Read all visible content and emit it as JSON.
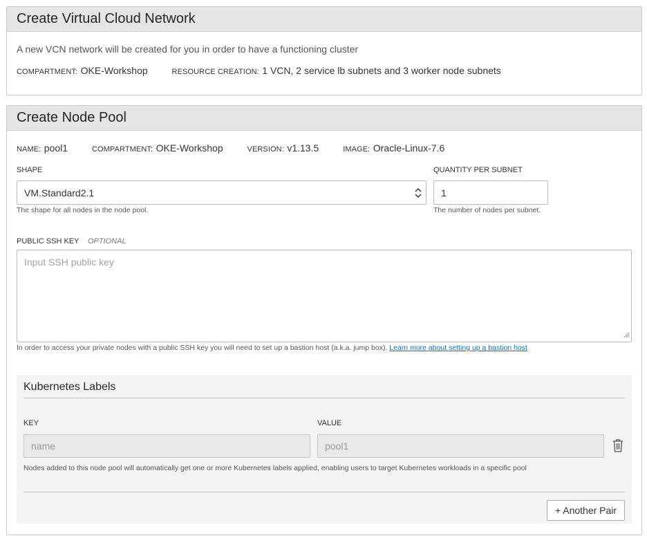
{
  "vcn": {
    "title": "Create Virtual Cloud Network",
    "description": "A new VCN network will be created for you in order to have a functioning cluster",
    "compartment_label": "COMPARTMENT:",
    "compartment_value": "OKE-Workshop",
    "resource_label": "RESOURCE CREATION:",
    "resource_value": "1 VCN, 2 service lb subnets and 3 worker node subnets"
  },
  "node_pool": {
    "title": "Create Node Pool",
    "name_label": "NAME:",
    "name_value": "pool1",
    "compartment_label": "COMPARTMENT:",
    "compartment_value": "OKE-Workshop",
    "version_label": "VERSION:",
    "version_value": "v1.13.5",
    "image_label": "IMAGE:",
    "image_value": "Oracle-Linux-7.6",
    "shape": {
      "label": "SHAPE",
      "value": "VM.Standard2.1",
      "help": "The shape for all nodes in the node pool."
    },
    "quantity": {
      "label": "QUANTITY PER SUBNET",
      "value": "1",
      "help": "The number of nodes per subnet."
    },
    "ssh": {
      "label": "PUBLIC SSH KEY",
      "optional": "OPTIONAL",
      "placeholder": "Input SSH public key",
      "help": "In order to access your private nodes with a public SSH key you will need to set up a bastion host (a.k.a. jump box).",
      "link": "Learn more about setting up a bastion host"
    }
  },
  "labels": {
    "title": "Kubernetes Labels",
    "key_label": "KEY",
    "value_label": "VALUE",
    "key_value": "name",
    "value_value": "pool1",
    "help": "Nodes added to this node pool will automatically get one or more Kubernetes labels applied, enabling users to target Kubernetes workloads in a specific pool",
    "add_button": "+ Another Pair"
  }
}
